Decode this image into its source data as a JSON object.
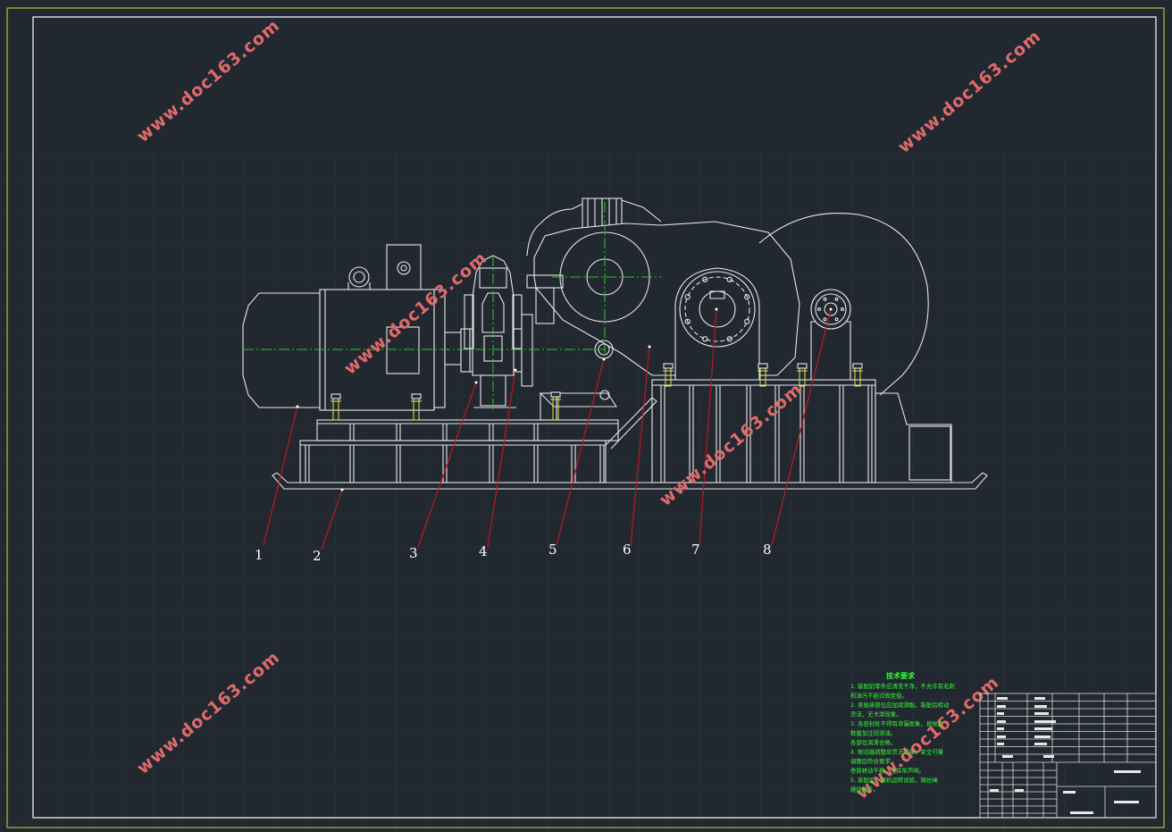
{
  "drawing": {
    "part_numbers": [
      "1",
      "2",
      "3",
      "4",
      "5",
      "6",
      "7",
      "8"
    ]
  },
  "watermark": {
    "text": "www.doc163.com"
  },
  "notes": {
    "title": "技术要求",
    "lines": [
      "1. 装配前零件应清洗干净，不允许有毛刺",
      "   和油污不超过规定值。",
      "2. 各轴承部位应加润滑脂，装配后转动",
      "   灵活，无卡滞现象。",
      "3. 各密封处不得有渗漏现象，按规定",
      "   数量加注润滑油。",
      "   各部位润滑合格。",
      "4. 制动器调整应灵活可靠，安全可靠",
      "   调整后符合要求。",
      "   卷筒转动平稳，无异常声响。",
      "5. 装配后，整机运转试验，钢丝绳",
      "   缠绕整齐。"
    ]
  },
  "title_block": {
    "school": "",
    "drawing_title": "",
    "cells": []
  }
}
